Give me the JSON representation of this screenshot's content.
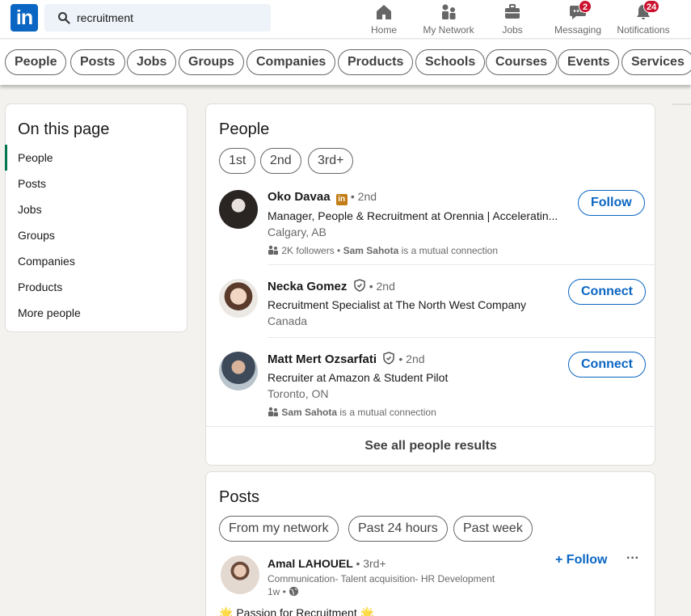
{
  "nav": {
    "logo": "in",
    "search_value": "recruitment",
    "items": [
      {
        "label": "Home"
      },
      {
        "label": "My Network"
      },
      {
        "label": "Jobs"
      },
      {
        "label": "Messaging",
        "badge": "2"
      },
      {
        "label": "Notifications",
        "badge": "24"
      }
    ]
  },
  "filters": [
    "People",
    "Posts",
    "Jobs",
    "Groups",
    "Companies",
    "Products",
    "Schools",
    "Courses",
    "Events",
    "Services"
  ],
  "on_this_page": {
    "title": "On this page",
    "items": [
      "People",
      "Posts",
      "Jobs",
      "Groups",
      "Companies",
      "Products",
      "More people"
    ]
  },
  "people": {
    "title": "People",
    "degree_filters": [
      "1st",
      "2nd",
      "3rd+"
    ],
    "results": [
      {
        "name": "Oko Davaa",
        "degree": "• 2nd",
        "title": "Manager, People & Recruitment at Orennia | Acceleratin...",
        "location": "Calgary, AB",
        "mutual_prefix": "2K followers • ",
        "mutual_name": "Sam Sahota",
        "mutual_suffix": " is a mutual connection",
        "action": "Follow"
      },
      {
        "name": "Necka Gomez",
        "degree": "• 2nd",
        "title": "Recruitment Specialist at The North West Company",
        "location": "Canada",
        "action": "Connect"
      },
      {
        "name": "Matt Mert Ozsarfati",
        "degree": "• 2nd",
        "title": "Recruiter at Amazon & Student Pilot",
        "location": "Toronto, ON",
        "mutual_name": "Sam Sahota",
        "mutual_suffix": " is a mutual connection",
        "action": "Connect"
      }
    ],
    "see_all": "See all people results"
  },
  "posts": {
    "title": "Posts",
    "filters": [
      "From my network",
      "Past 24 hours",
      "Past week"
    ],
    "first_post": {
      "author": "Amal LAHOUEL",
      "degree": "• 3rd+",
      "headline": "Communication- Talent acquisition- HR Development",
      "time": "1w •",
      "follow_label": "+ Follow",
      "more": "···",
      "text": "🌟 Passion for Recruitment 🌟"
    }
  }
}
